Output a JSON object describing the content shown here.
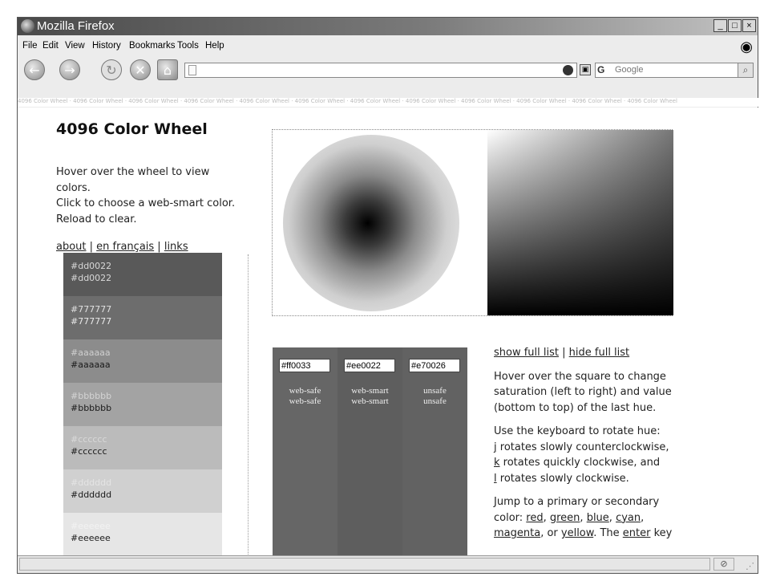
{
  "window": {
    "title": "Mozilla Firefox",
    "buttons": [
      "_",
      "□",
      "×"
    ]
  },
  "menu": {
    "items": [
      "File",
      "Edit",
      "View",
      "History",
      "Bookmarks",
      "Tools",
      "Help"
    ]
  },
  "toolbar": {
    "back": "←",
    "forward": "→",
    "reload": "↻",
    "stop": "✕",
    "home": "⌂",
    "url": "",
    "search_engine": "G",
    "search_placeholder": "Google",
    "search_icon": "⌕"
  },
  "tagline": "4096 Color Wheel · 4096 Color Wheel · 4096 Color Wheel · 4096 Color Wheel · 4096 Color Wheel · 4096 Color Wheel · 4096 Color Wheel · 4096 Color Wheel · 4096 Color Wheel · 4096 Color Wheel · 4096 Color Wheel · 4096 Color Wheel",
  "page": {
    "title": "4096 Color Wheel",
    "intro_1": "Hover over the wheel to view colors.",
    "intro_2": "Click to choose a web-smart color.",
    "intro_3": "Reload to clear.",
    "link_about": "about",
    "link_sep1": " | ",
    "link_french": "en français",
    "link_sep2": " | ",
    "link_links": "links"
  },
  "swatches": [
    {
      "label1": "#dd0022",
      "label2": "#dd0022",
      "bg": "#595959",
      "fg1": "#d8d8d8",
      "fg2": "#d8d8d8"
    },
    {
      "label1": "#777777",
      "label2": "#777777",
      "bg": "#6d6d6d",
      "fg1": "#e0e0e0",
      "fg2": "#e8e8e8"
    },
    {
      "label1": "#aaaaaa",
      "label2": "#aaaaaa",
      "bg": "#8c8c8c",
      "fg1": "#cfcfcf",
      "fg2": "#1a1a1a"
    },
    {
      "label1": "#bbbbbb",
      "label2": "#bbbbbb",
      "bg": "#a3a3a3",
      "fg1": "#d4d4d4",
      "fg2": "#1a1a1a"
    },
    {
      "label1": "#cccccc",
      "label2": "#cccccc",
      "bg": "#bbbbbb",
      "fg1": "#d9d9d9",
      "fg2": "#1a1a1a"
    },
    {
      "label1": "#dddddd",
      "label2": "#dddddd",
      "bg": "#d0d0d0",
      "fg1": "#e4e4e4",
      "fg2": "#1a1a1a"
    },
    {
      "label1": "#eeeeee",
      "label2": "#eeeeee",
      "bg": "#e6e6e6",
      "fg1": "#f2f2f2",
      "fg2": "#1a1a1a"
    }
  ],
  "pickers": [
    {
      "value": "#ff0033",
      "label1": "web-safe",
      "label2": "web-safe",
      "bg": "#666666"
    },
    {
      "value": "#ee0022",
      "label1": "web-smart",
      "label2": "web-smart",
      "bg": "#5e5e5e"
    },
    {
      "value": "#e70026",
      "label1": "unsafe",
      "label2": "unsafe",
      "bg": "#626262"
    }
  ],
  "right": {
    "show_full": "show full list",
    "sep": " | ",
    "hide_full": "hide full list",
    "p1": "Hover over the square to change saturation (left to right) and value (bottom to top) of the last hue.",
    "p2_lead": "Use the keyboard to rotate hue:",
    "key_j": "j",
    "p2_j": " rotates slowly counterclockwise,",
    "key_k": "k",
    "p2_k": " rotates quickly clockwise, and",
    "key_l": "l",
    "p2_l": " rotates slowly clockwise.",
    "p3_lead": "Jump to a primary or secondary color: ",
    "c_red": "red",
    "c_sep1": ", ",
    "c_green": "green",
    "c_sep2": ", ",
    "c_blue": "blue",
    "c_sep3": ", ",
    "c_cyan": "cyan",
    "c_sep4": ", ",
    "c_magenta": "magenta",
    "c_or": ", or ",
    "c_yellow": "yellow",
    "p3_tail": ". The ",
    "enter": "enter",
    "key_word": " key"
  },
  "status": {
    "text": "",
    "icon": "⊘",
    "grip": "⋰"
  }
}
